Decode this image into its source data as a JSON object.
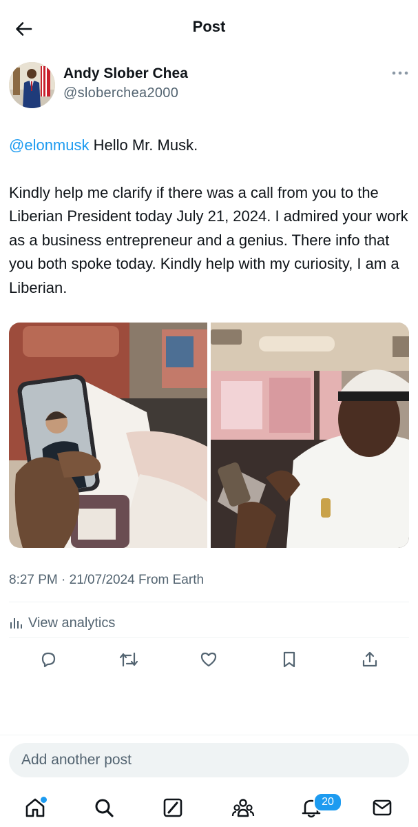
{
  "header": {
    "title": "Post",
    "back_icon": "arrow-left-icon"
  },
  "author": {
    "name": "Andy Slober Chea",
    "handle": "@sloberchea2000",
    "more_icon": "more-dots-icon"
  },
  "post": {
    "mention": "@elonmusk",
    "greeting": " Hello Mr. Musk.",
    "body": "Kindly help me clarify if there was a call from you to the Liberian President today July 21, 2024. I admired your work as a business entrepreneur and a genius. There info that you both spoke today. Kindly help with my curiosity, I am a Liberian.",
    "timestamp": "8:27 PM · 21/07/2024 From Earth",
    "analytics_label": "View analytics"
  },
  "actions": [
    {
      "name": "reply",
      "icon": "reply-icon"
    },
    {
      "name": "repost",
      "icon": "repost-icon"
    },
    {
      "name": "like",
      "icon": "heart-icon"
    },
    {
      "name": "bookmark",
      "icon": "bookmark-icon"
    },
    {
      "name": "share",
      "icon": "share-icon"
    }
  ],
  "composer": {
    "placeholder": "Add another post"
  },
  "bottom_nav": {
    "items": [
      {
        "name": "home",
        "icon": "home-icon",
        "active": true
      },
      {
        "name": "search",
        "icon": "search-icon"
      },
      {
        "name": "grok",
        "icon": "grok-icon"
      },
      {
        "name": "communities",
        "icon": "communities-icon"
      },
      {
        "name": "notifications",
        "icon": "bell-icon"
      },
      {
        "name": "messages",
        "icon": "mail-icon"
      }
    ],
    "notifications_badge": "20"
  },
  "colors": {
    "accent": "#1d9bf0",
    "text_primary": "#0f1419",
    "text_secondary": "#536471",
    "divider": "#eff3f4"
  }
}
